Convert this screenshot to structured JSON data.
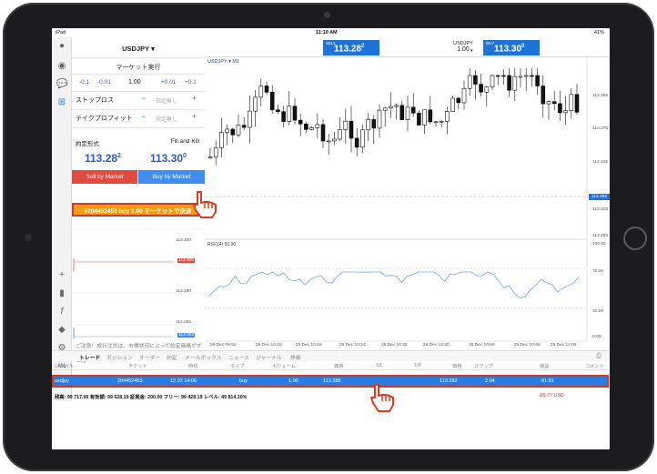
{
  "statusbar": {
    "device": "iPad",
    "time": "11:10 AM",
    "battery": "41%"
  },
  "order_panel": {
    "symbol": "USDJPY ▾",
    "execution": "マーケット実行",
    "volume_buttons": [
      "-0.1",
      "-0.01",
      "+0.01",
      "+0.1"
    ],
    "volume": "1.00",
    "stop_loss_label": "ストップロス",
    "take_profit_label": "テイクプロフィット",
    "placeholder": "指定無し",
    "fill_label": "約定形式",
    "fill_value": "Fill and Kill",
    "bid_main": "113.28",
    "bid_sup": "2",
    "ask_main": "113.30",
    "ask_sup": "0",
    "sell_button": "Sell by Market",
    "buy_button": "Buy by Market",
    "close_button": "#204452453 buy 1.00 マーケットで決済",
    "notice": "ご注意！成行注文は、市場状況によって約定価格がずれますので、必ずしも提示価格で約定するとは限りません!"
  },
  "quote_bar": {
    "sell_label": "SELL",
    "sell_main": "113.28",
    "sell_sup": "2",
    "symbol": "USDJPY",
    "volume": "1.00",
    "buy_label": "BUY",
    "buy_main": "113.30",
    "buy_sup": "0"
  },
  "chart": {
    "title": "USDJPY ▾ M1",
    "rsi_title": "RSI(14) 50.90",
    "current_price": "113.282",
    "y_labels": [
      "113.395",
      "113.370",
      "113.345",
      "113.320",
      "113.295"
    ],
    "rsi_labels": [
      "100.00",
      "70.00",
      "30.00",
      "0.00"
    ],
    "x_labels": [
      "26 Dec 09:54",
      "26 Dec 10:10",
      "26 Dec 10:18",
      "26 Dec 10:24",
      "26 Dec 10:32",
      "26 Dec 10:40",
      "26 Dec 10:50",
      "26 Dec 10:58",
      "26 Dec 11:06"
    ],
    "mini_labels": [
      "113.300",
      "113.295",
      "113.290",
      "113.285",
      "113.282"
    ],
    "mini_mark": "113.300"
  },
  "rail_icons": [
    "user-icon",
    "people-icon",
    "chat-icon",
    "new-order-icon",
    "crosshair-icon",
    "chart-type-icon",
    "function-icon",
    "objects-icon",
    "period-icon",
    "add-icon"
  ],
  "rail_period": "M1",
  "tabs": [
    "トレード",
    "ポジション",
    "オーダー",
    "約定",
    "メールボックス",
    "ニュース",
    "ジャーナル",
    "詳細"
  ],
  "table": {
    "headers": [
      "シンボル",
      "チケット",
      "時刻",
      "タイプ",
      "ボリューム",
      "価格",
      "S/L",
      "T/P",
      "価格",
      "スワップ",
      "損益",
      "コメント"
    ],
    "row": [
      "usdjpy",
      "204452453",
      "12.22 14:06",
      "buy",
      "1.00",
      "113.388",
      "",
      "",
      "113.282",
      "2.04",
      "-91.81",
      ""
    ]
  },
  "summary": {
    "text": "残高: 99 717.06 有効額: 99 628.19 証拠金: 200.00 フリー: 99 428.19 レベル: 49 814.10%",
    "pl": "-89.77  USD"
  }
}
